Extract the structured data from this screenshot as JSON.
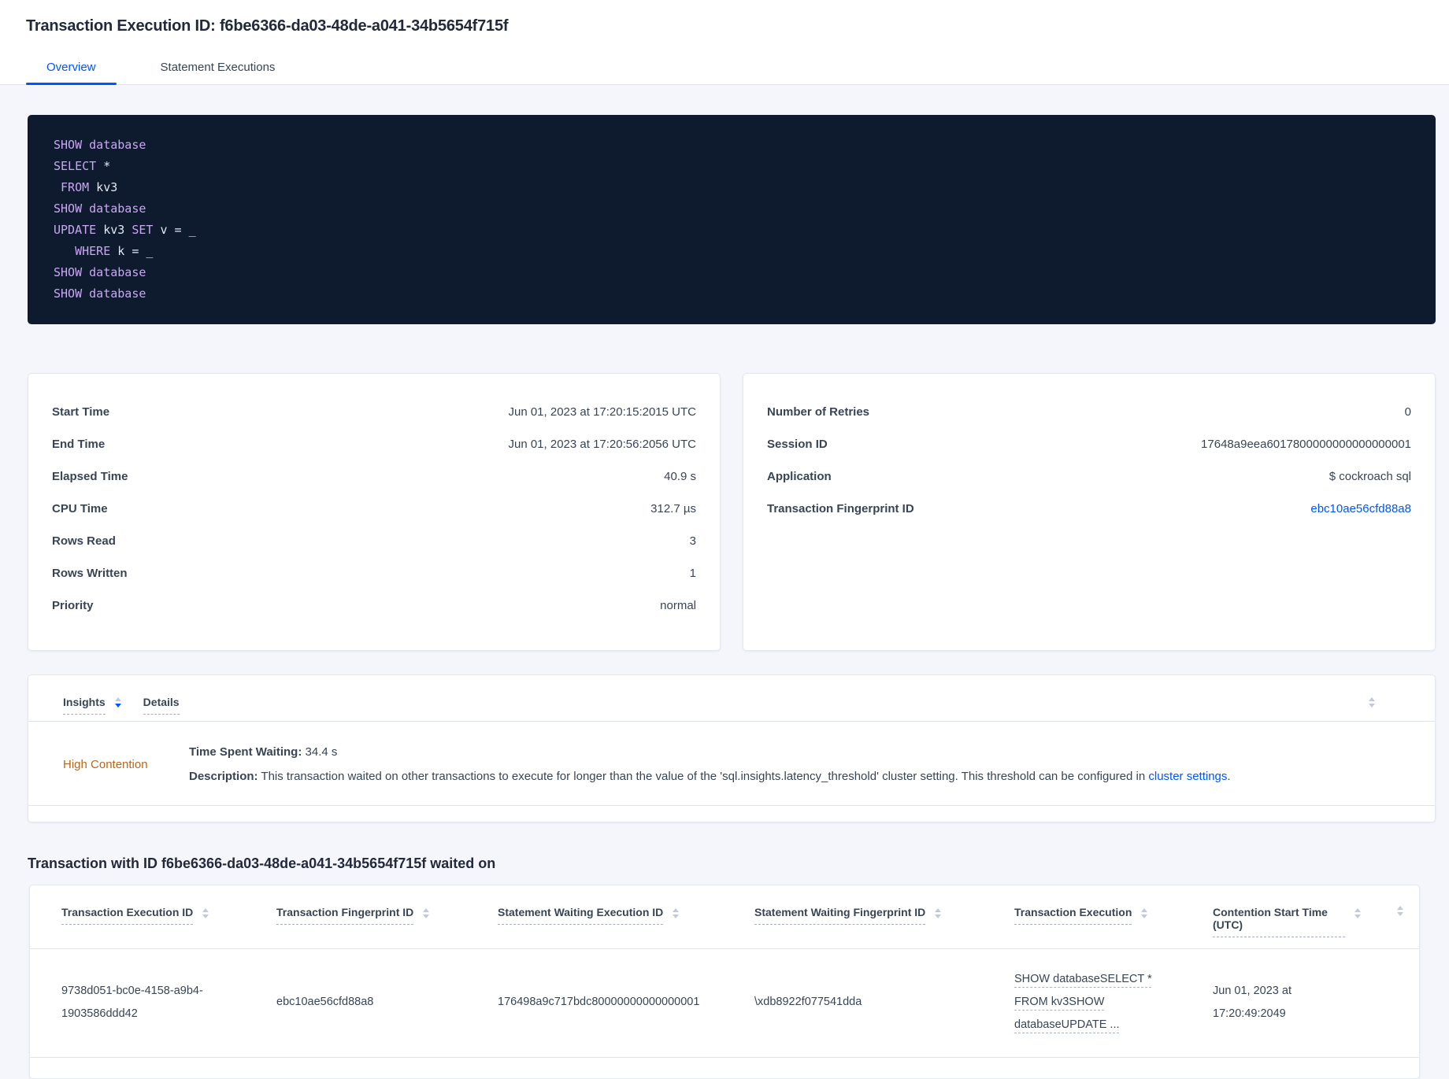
{
  "page": {
    "title": "Transaction Execution ID: f6be6366-da03-48de-a041-34b5654f715f"
  },
  "tabs": {
    "overview": "Overview",
    "statement_executions": "Statement Executions"
  },
  "sql": {
    "lines": [
      [
        [
          "k",
          "SHOW database"
        ]
      ],
      [
        [
          "k",
          "SELECT"
        ],
        [
          "p",
          " *"
        ]
      ],
      [
        [
          "p",
          " "
        ],
        [
          "k",
          "FROM"
        ],
        [
          "p",
          " kv3"
        ]
      ],
      [
        [
          "k",
          "SHOW database"
        ]
      ],
      [
        [
          "k",
          "UPDATE"
        ],
        [
          "p",
          " kv3 "
        ],
        [
          "k",
          "SET"
        ],
        [
          "p",
          " v = _"
        ]
      ],
      [
        [
          "p",
          "   "
        ],
        [
          "k",
          "WHERE"
        ],
        [
          "p",
          " k = _"
        ]
      ],
      [
        [
          "k",
          "SHOW database"
        ]
      ],
      [
        [
          "k",
          "SHOW database"
        ]
      ]
    ]
  },
  "stats_left": {
    "rows": [
      {
        "label": "Start Time",
        "value": "Jun 01, 2023 at 17:20:15:2015 UTC"
      },
      {
        "label": "End Time",
        "value": "Jun 01, 2023 at 17:20:56:2056 UTC"
      },
      {
        "label": "Elapsed Time",
        "value": "40.9 s"
      },
      {
        "label": "CPU Time",
        "value": "312.7 µs"
      },
      {
        "label": "Rows Read",
        "value": "3"
      },
      {
        "label": "Rows Written",
        "value": "1"
      },
      {
        "label": "Priority",
        "value": "normal"
      }
    ]
  },
  "stats_right": {
    "rows": [
      {
        "label": "Number of Retries",
        "value": "0"
      },
      {
        "label": "Session ID",
        "value": "17648a9eea6017800000000000000001"
      },
      {
        "label": "Application",
        "value": "$ cockroach sql"
      },
      {
        "label": "Transaction Fingerprint ID",
        "value": "ebc10ae56cfd88a8",
        "link": true
      }
    ]
  },
  "insights": {
    "col_insights": "Insights",
    "col_details": "Details",
    "row_insight": "High Contention",
    "time_label": "Time Spent Waiting:",
    "time_value": " 34.4 s",
    "desc_label": "Description:",
    "desc_before": " This transaction waited on other transactions to execute for longer than the value of the 'sql.insights.latency_threshold' cluster setting. This threshold can be configured in ",
    "desc_link": "cluster settings",
    "desc_after": "."
  },
  "waited_on": {
    "heading": "Transaction with ID f6be6366-da03-48de-a041-34b5654f715f waited on",
    "columns": [
      "Transaction Execution ID",
      "Transaction Fingerprint ID",
      "Statement Waiting Execution ID",
      "Statement Waiting Fingerprint ID",
      "Transaction Execution",
      "Contention Start Time (UTC)"
    ],
    "row": [
      "9738d051-bc0e-4158-a9b4-1903586ddd42",
      "ebc10ae56cfd88a8",
      "176498a9c717bdc80000000000000001",
      "\\xdb8922f077541dda",
      "SHOW databaseSELECT * FROM kv3SHOW databaseUPDATE ...",
      "Jun 01, 2023 at 17:20:49:2049"
    ]
  },
  "colors": {
    "accent_blue": "#0055ff",
    "insight_orange": "#b8651b",
    "code_background": "#0e1a2e",
    "code_keyword": "#c9a8f2"
  }
}
